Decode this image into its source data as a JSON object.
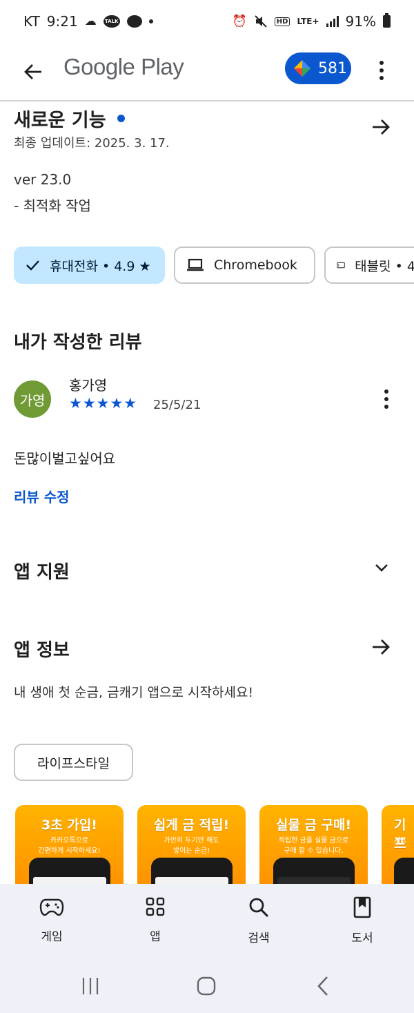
{
  "status_bar": {
    "carrier": "KT",
    "time": "9:21",
    "network": "LTE+",
    "battery": "91%",
    "hd": "HD",
    "talk": "TALK"
  },
  "app_bar": {
    "title": "Google Play",
    "points": "581"
  },
  "whats_new": {
    "title": "새로운 기능",
    "updated": "최종 업데이트: 2025. 3. 17.",
    "version": "ver 23.0",
    "notes": "- 최적화 작업"
  },
  "device_chips": [
    {
      "label": "휴대전화 • 4.9 ★",
      "selected": true
    },
    {
      "label": "Chromebook",
      "selected": false
    },
    {
      "label": "태블릿 • 4",
      "selected": false
    }
  ],
  "my_review": {
    "title": "내가 작성한 리뷰",
    "avatar_text": "가영",
    "reviewer": "홍가영",
    "stars": "★★★★★",
    "rating": 5,
    "date": "25/5/21",
    "text": "돈많이벌고싶어요",
    "edit_label": "리뷰 수정"
  },
  "app_support": {
    "title": "앱 지원"
  },
  "about": {
    "title": "앱 정보",
    "description": "내 생애 첫 순금, 금캐기 앱으로 시작하세요!",
    "category": "라이프스타일"
  },
  "screenshots": [
    {
      "title": "3초 가입!",
      "line1": "카카오톡으로",
      "line2": "간편하게 시작하세요!"
    },
    {
      "title": "쉽게 금 적립!",
      "line1": "가만히 두기만 해도",
      "line2": "쌓이는 순금!"
    },
    {
      "title": "실물 금 구매!",
      "line1": "적립한 금을 실물 금으로",
      "line2": "구매 할 수 있습니다."
    },
    {
      "title": "기프",
      "line1": "기프",
      "line2": ""
    }
  ],
  "bottom_nav": [
    {
      "label": "게임",
      "icon": "gamepad-icon"
    },
    {
      "label": "앱",
      "icon": "apps-grid-icon"
    },
    {
      "label": "검색",
      "icon": "search-icon"
    },
    {
      "label": "도서",
      "icon": "book-icon"
    }
  ],
  "colors": {
    "accent": "#0b57d0",
    "chip_selected": "#c2e7ff",
    "avatar": "#6f9a34",
    "nav_bg": "#eef2f8",
    "shot_bg": "#ffa000"
  }
}
